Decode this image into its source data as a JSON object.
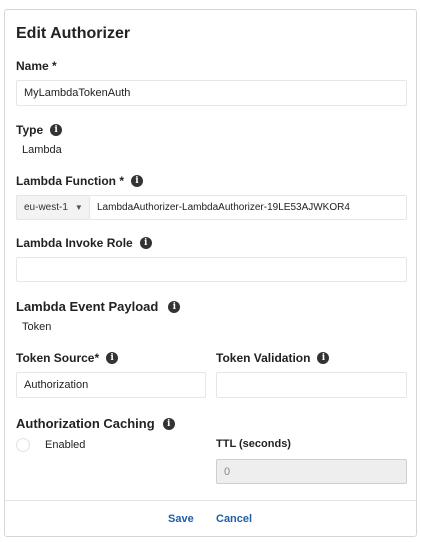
{
  "dialog": {
    "title": "Edit Authorizer"
  },
  "name": {
    "label": "Name *",
    "value": "MyLambdaTokenAuth"
  },
  "type": {
    "label": "Type",
    "value": "Lambda"
  },
  "lambda_function": {
    "label": "Lambda Function *",
    "region": "eu-west-1",
    "value": "LambdaAuthorizer-LambdaAuthorizer-19LE53AJWKOR4"
  },
  "invoke_role": {
    "label": "Lambda Invoke Role",
    "value": ""
  },
  "event_payload": {
    "label": "Lambda Event Payload",
    "value": "Token"
  },
  "token_source": {
    "label": "Token Source*",
    "value": "Authorization"
  },
  "token_validation": {
    "label": "Token Validation",
    "value": ""
  },
  "caching": {
    "label": "Authorization Caching",
    "enabled_label": "Enabled",
    "ttl_label": "TTL (seconds)",
    "ttl_value": "0"
  },
  "footer": {
    "save_label": "Save",
    "cancel_label": "Cancel"
  },
  "colors": {
    "link": "#1f5fa8",
    "icon": "#333333"
  },
  "icons": {
    "info": "info-icon",
    "dropdown": "chevron-down-icon"
  }
}
